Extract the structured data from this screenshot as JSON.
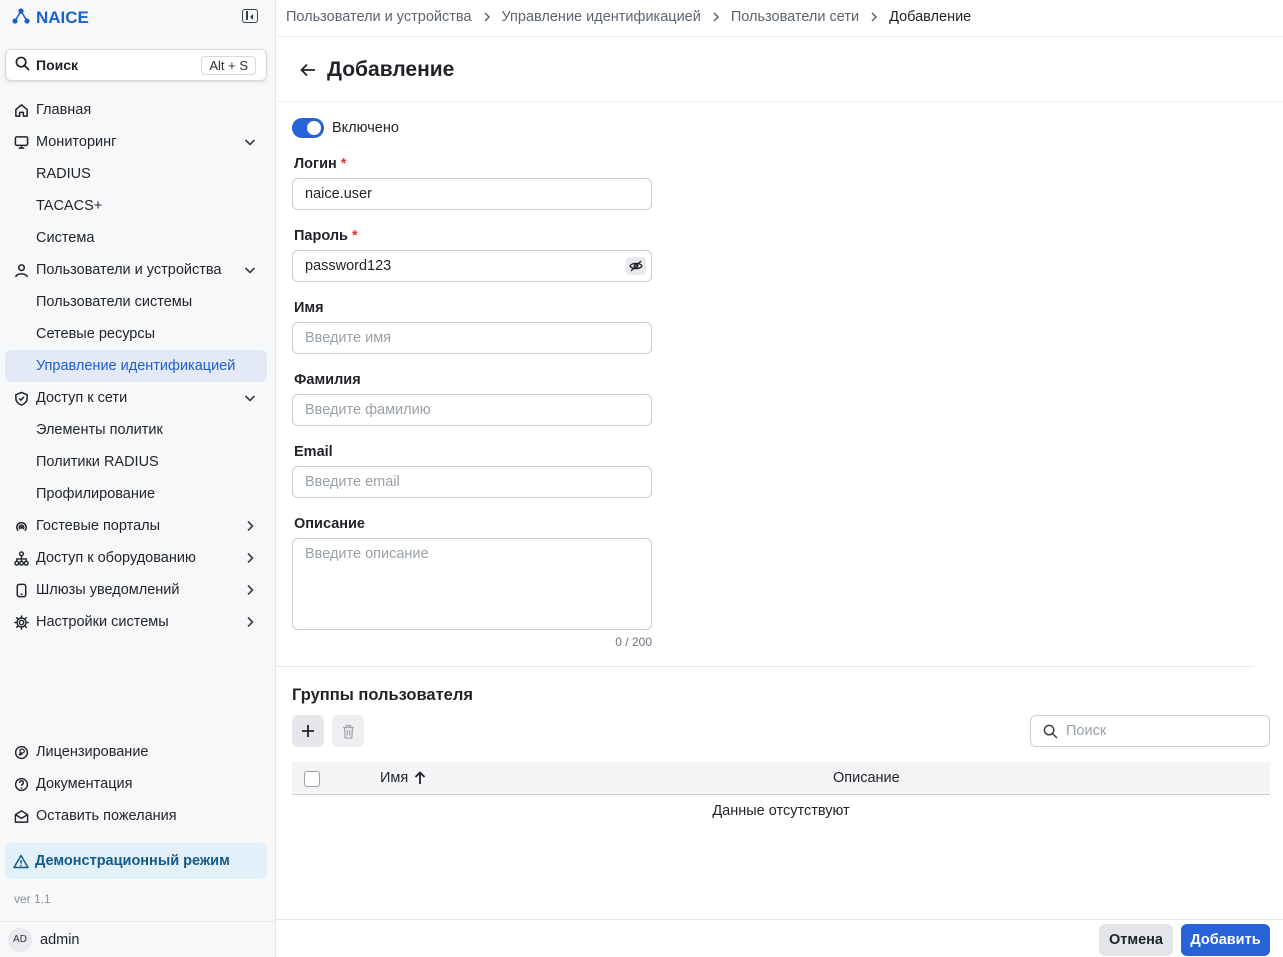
{
  "app": {
    "name": "NAICE",
    "logo_icon": "nodes-icon"
  },
  "sidebar": {
    "search": {
      "label": "Поиск",
      "shortcut": "Alt + S"
    },
    "items": [
      {
        "label": "Главная",
        "icon": "home-icon"
      },
      {
        "label": "Мониторинг",
        "icon": "monitor-icon",
        "expanded": true
      },
      {
        "label": "RADIUS"
      },
      {
        "label": "TACACS+"
      },
      {
        "label": "Система"
      },
      {
        "label": "Пользователи и устройства",
        "icon": "user-icon",
        "expanded": true
      },
      {
        "label": "Пользователи системы"
      },
      {
        "label": "Сетевые ресурсы"
      },
      {
        "label": "Управление идентификацией",
        "active": true
      },
      {
        "label": "Доступ к сети",
        "icon": "shield-check-icon",
        "expanded": true
      },
      {
        "label": "Элементы политик"
      },
      {
        "label": "Политики RADIUS"
      },
      {
        "label": "Профилирование"
      },
      {
        "label": "Гостевые порталы",
        "icon": "wifi-icon"
      },
      {
        "label": "Доступ к оборудованию",
        "icon": "network-icon"
      },
      {
        "label": "Шлюзы уведомлений",
        "icon": "device-icon"
      },
      {
        "label": "Настройки системы",
        "icon": "gear-icon"
      }
    ],
    "bottom_items": [
      {
        "label": "Лицензирование",
        "icon": "license-icon"
      },
      {
        "label": "Документация",
        "icon": "help-icon"
      },
      {
        "label": "Оставить пожелания",
        "icon": "mail-icon"
      }
    ],
    "demo_mode": "Демонстрационный режим",
    "version": "ver 1.1",
    "user": {
      "initials": "AD",
      "name": "admin"
    }
  },
  "breadcrumb": [
    "Пользователи и устройства",
    "Управление идентификацией",
    "Пользователи сети",
    "Добавление"
  ],
  "page": {
    "title": "Добавление"
  },
  "form": {
    "enabled_label": "Включено",
    "enabled": true,
    "login": {
      "label": "Логин",
      "value": "naice.user",
      "required": true
    },
    "password": {
      "label": "Пароль",
      "value": "password123",
      "required": true
    },
    "first_name": {
      "label": "Имя",
      "placeholder": "Введите имя"
    },
    "last_name": {
      "label": "Фамилия",
      "placeholder": "Введите фамилию"
    },
    "email": {
      "label": "Email",
      "placeholder": "Введите email"
    },
    "description": {
      "label": "Описание",
      "placeholder": "Введите описание",
      "counter": "0 / 200"
    }
  },
  "groups": {
    "title": "Группы пользователя",
    "search_placeholder": "Поиск",
    "columns": {
      "name": "Имя",
      "description": "Описание"
    },
    "empty": "Данные отсутствуют"
  },
  "footer": {
    "cancel": "Отмена",
    "submit": "Добавить"
  },
  "colors": {
    "accent": "#2763d6",
    "brand": "#1d5fd1",
    "active_bg": "#e3e9f6",
    "demo_bg": "#e2f0f9",
    "required": "#d63a3a"
  }
}
